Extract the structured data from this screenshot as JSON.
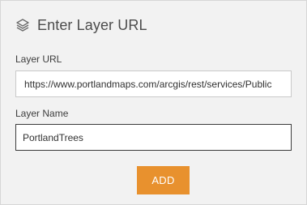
{
  "header": {
    "icon": "layers-icon",
    "title": "Enter Layer URL"
  },
  "form": {
    "url_label": "Layer URL",
    "url_value": "https://www.portlandmaps.com/arcgis/rest/services/Public",
    "name_label": "Layer Name",
    "name_value": "PortlandTrees",
    "add_label": "ADD"
  },
  "colors": {
    "panel_bg": "#f2f2f2",
    "accent": "#e8912e",
    "text": "#4c4c4c"
  }
}
